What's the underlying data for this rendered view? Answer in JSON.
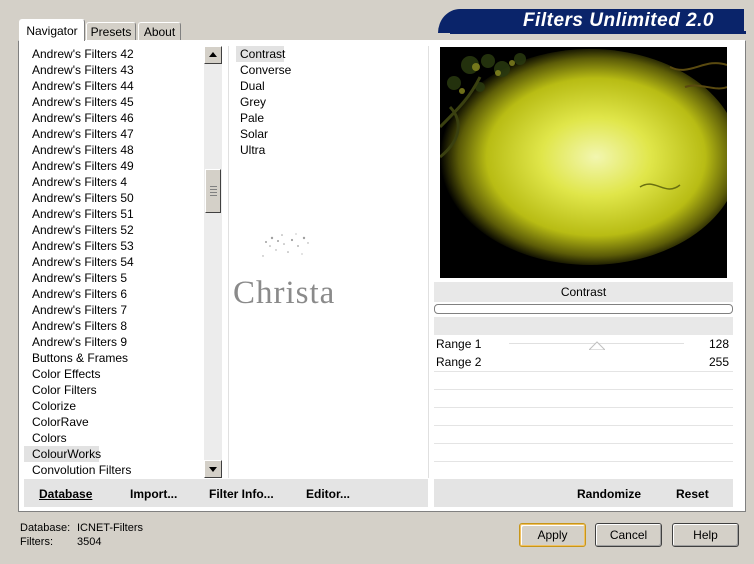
{
  "tabs": [
    {
      "label": "Navigator",
      "active": true
    },
    {
      "label": "Presets",
      "active": false
    },
    {
      "label": "About",
      "active": false
    }
  ],
  "banner_title": "Filters Unlimited 2.0",
  "categories": [
    "Andrew's Filters 42",
    "Andrew's Filters 43",
    "Andrew's Filters 44",
    "Andrew's Filters 45",
    "Andrew's Filters 46",
    "Andrew's Filters 47",
    "Andrew's Filters 48",
    "Andrew's Filters 49",
    "Andrew's Filters 4",
    "Andrew's Filters 50",
    "Andrew's Filters 51",
    "Andrew's Filters 52",
    "Andrew's Filters 53",
    "Andrew's Filters 54",
    "Andrew's Filters 5",
    "Andrew's Filters 6",
    "Andrew's Filters 7",
    "Andrew's Filters 8",
    "Andrew's Filters 9",
    "Buttons & Frames",
    "Color Effects",
    "Color Filters",
    "Colorize",
    "ColorRave",
    "Colors",
    "ColourWorks",
    "Convolution Filters"
  ],
  "selected_category": "ColourWorks",
  "filters": [
    "Contrast",
    "Converse",
    "Dual",
    "Grey",
    "Pale",
    "Solar",
    "Ultra"
  ],
  "selected_filter": "Contrast",
  "watermark_text": "Christa",
  "preview_filter_name": "Contrast",
  "ranges": [
    {
      "label": "Range 1",
      "value": "128",
      "level": 0.5
    },
    {
      "label": "Range 2",
      "value": "255",
      "level": 1.0
    }
  ],
  "left_toolbar": {
    "database": "Database",
    "import": "Import...",
    "filter_info": "Filter Info...",
    "editor": "Editor..."
  },
  "right_toolbar": {
    "randomize": "Randomize",
    "reset": "Reset"
  },
  "status": {
    "database_label": "Database:",
    "database_value": "ICNET-Filters",
    "filters_label": "Filters:",
    "filters_value": "3504"
  },
  "buttons": {
    "apply": "Apply",
    "cancel": "Cancel",
    "help": "Help"
  },
  "colors": {
    "banner": "#0a246a",
    "window": "#d4d0c8",
    "apply_border": "#c7961a"
  }
}
